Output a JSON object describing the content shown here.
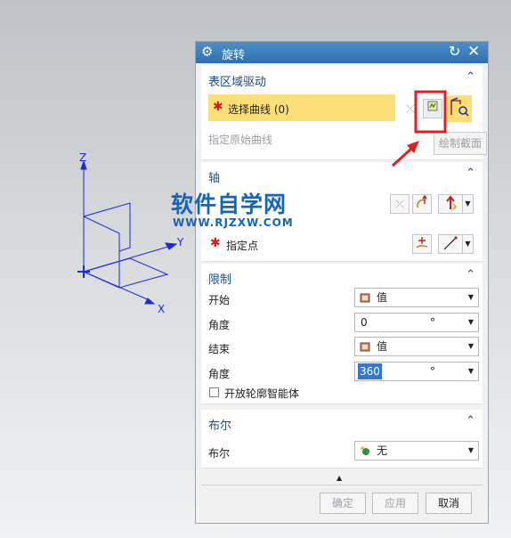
{
  "colors": {
    "title_bar": "#3a7dbc",
    "group_header": "#1f4e87",
    "selection_highlight": "#fddf78",
    "required_star": "#d81b1b",
    "annotation": "#e02020",
    "axes": "#1a2adf"
  },
  "viewport": {
    "axis_labels": {
      "z": "Z",
      "y": "Y",
      "x": "X"
    }
  },
  "watermark": {
    "line1": "软件自学网",
    "line2": "WWW.RJZXW.COM"
  },
  "dialog": {
    "title": "旋转",
    "icons": [
      "gear-icon",
      "reset-icon",
      "close-icon"
    ],
    "sections": {
      "section_drive": {
        "header": "表区域驱动",
        "select_curve_label": "选择曲线 (0)",
        "specify_origin_label": "指定原始曲线",
        "tooltip": "绘制截面"
      },
      "axis": {
        "header": "轴",
        "specify_point_label": "指定点"
      },
      "limits": {
        "header": "限制",
        "start_label": "开始",
        "start_mode": "值",
        "start_angle_label": "角度",
        "start_angle": "0",
        "end_label": "结束",
        "end_mode": "值",
        "end_angle_label": "角度",
        "end_angle": "360",
        "unit": "°",
        "open_profile_label": "开放轮廓智能体"
      },
      "boolean": {
        "header": "布尔",
        "label": "布尔",
        "value": "无"
      }
    },
    "buttons": {
      "ok": "确定",
      "apply": "应用",
      "cancel": "取消"
    }
  }
}
